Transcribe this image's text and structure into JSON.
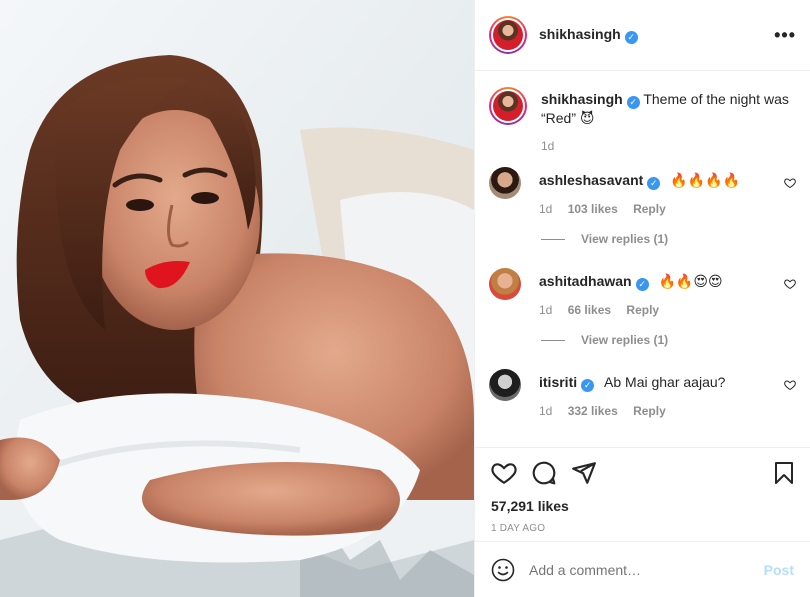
{
  "post": {
    "author": "shikhasingh",
    "caption_text": "Theme of the night was “Red” 😈",
    "caption_time": "1d"
  },
  "comments": [
    {
      "user": "ashleshasavant",
      "text": "🔥🔥🔥🔥",
      "time": "1d",
      "likes": "103 likes",
      "reply": "Reply",
      "view_replies": "View replies (1)"
    },
    {
      "user": "ashitadhawan",
      "text": "🔥🔥😍😍",
      "time": "1d",
      "likes": "66 likes",
      "reply": "Reply",
      "view_replies": "View replies (1)"
    },
    {
      "user": "itisriti",
      "text": "Ab Mai ghar aajau?",
      "time": "1d",
      "likes": "332 likes",
      "reply": "Reply"
    }
  ],
  "stats": {
    "likes": "57,291 likes",
    "posted": "1 DAY AGO"
  },
  "compose": {
    "placeholder": "Add a comment…",
    "post_label": "Post"
  },
  "icons": {
    "more": "more-options-icon",
    "like": "heart-icon",
    "comment": "comment-icon",
    "share": "share-icon",
    "save": "bookmark-icon",
    "emoji": "emoji-icon"
  },
  "colors": {
    "verified": "#3897f0",
    "post_disabled": "#b2dffc",
    "muted": "#8e8e8e"
  }
}
